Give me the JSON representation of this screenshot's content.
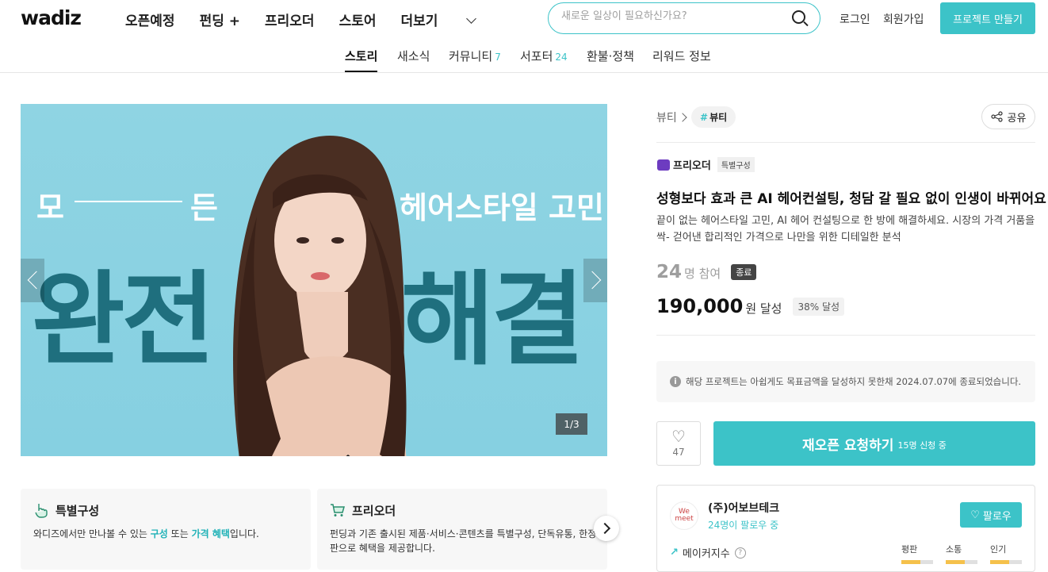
{
  "header": {
    "logo": "wadiz",
    "nav": [
      "오픈예정",
      "펀딩 +",
      "프리오더",
      "스토어",
      "더보기"
    ],
    "search_placeholder": "새로운 일상이 필요하신가요?",
    "login": "로그인",
    "signup": "회원가입",
    "make_project": "프로젝트 만들기"
  },
  "tabs": [
    {
      "label": "스토리",
      "count": ""
    },
    {
      "label": "새소식",
      "count": ""
    },
    {
      "label": "커뮤니티",
      "count": "7"
    },
    {
      "label": "서포터",
      "count": "24"
    },
    {
      "label": "환불·정책",
      "count": ""
    },
    {
      "label": "리워드 정보",
      "count": ""
    }
  ],
  "hero": {
    "line1_a": "모",
    "line1_b": "든",
    "line1_c": "헤어스타일 고민",
    "big_left": "완전",
    "big_right": "해결",
    "pager": "1/3"
  },
  "features": [
    {
      "title": "특별구성",
      "desc_pre": "와디즈에서만 만나볼 수 있는 ",
      "hl1": "구성",
      "mid": " 또는 ",
      "hl2": "가격 혜택",
      "desc_post": "입니다."
    },
    {
      "title": "프리오더",
      "desc": "펀딩과 기존 출시된 제품·서비스·콘텐츠를 특별구성, 단독유통, 한정판으로 혜택을 제공합니다."
    }
  ],
  "project": {
    "category": "뷰티",
    "tag": "뷰티",
    "share": "공유",
    "type": "프리오더",
    "type_chip": "특별구성",
    "title": "성형보다 효과 큰 AI 헤어컨설팅, 청담 갈 필요 없이 인생이 바뀌어요",
    "description": "끝이 없는 헤어스타일 고민, AI 헤어 컨설팅으로 한 방에 해결하세요. 시장의 가격 거품을 싹- 걷어낸 합리적인 가격으로 나만을 위한 디테일한 분석",
    "supporters": "24",
    "supporters_unit": "명 참여",
    "status": "종료",
    "amount": "190,000",
    "amount_unit": "원 달성",
    "percent": "38% 달성",
    "notice": "해당 프로젝트는 아쉽게도 목표금액을 달성하지 못한채 2024.07.07에 종료되었습니다.",
    "likes": "47",
    "reopen_label": "재오픈 요청하기",
    "reopen_sub": "15명 신청 중"
  },
  "maker": {
    "avatar_text": "We meet",
    "name": "(주)어보브테크",
    "followers": "24명이 팔로우 중",
    "follow": "팔로우",
    "index_label": "메이커지수",
    "metrics": [
      {
        "label": "평판",
        "level": 0.6
      },
      {
        "label": "소통",
        "level": 0.6
      },
      {
        "label": "인기",
        "level": 0.6
      }
    ]
  },
  "colors": {
    "accent": "#3cc3c8",
    "hero_bg": "#8fd4e3",
    "hero_text": "#1f6f7e"
  }
}
